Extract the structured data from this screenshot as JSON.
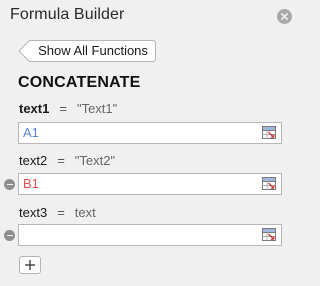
{
  "panel": {
    "title": "Formula Builder",
    "back_button_label": "Show All Functions",
    "function_name": "CONCATENATE"
  },
  "arguments": [
    {
      "name": "text1",
      "equals": "=",
      "preview": "\"Text1\"",
      "value": "A1",
      "value_color": "#5b86d6",
      "required": true
    },
    {
      "name": "text2",
      "equals": "=",
      "preview": "\"Text2\"",
      "value": "B1",
      "value_color": "#d9534f",
      "required": false
    },
    {
      "name": "text3",
      "equals": "=",
      "preview": "text",
      "value": "",
      "value_color": "#333333",
      "required": false
    }
  ],
  "icons": {
    "close": "close-circle-icon",
    "cell_reference": "cell-reference-picker-icon",
    "remove": "minus-circle-icon",
    "add": "plus-icon"
  }
}
